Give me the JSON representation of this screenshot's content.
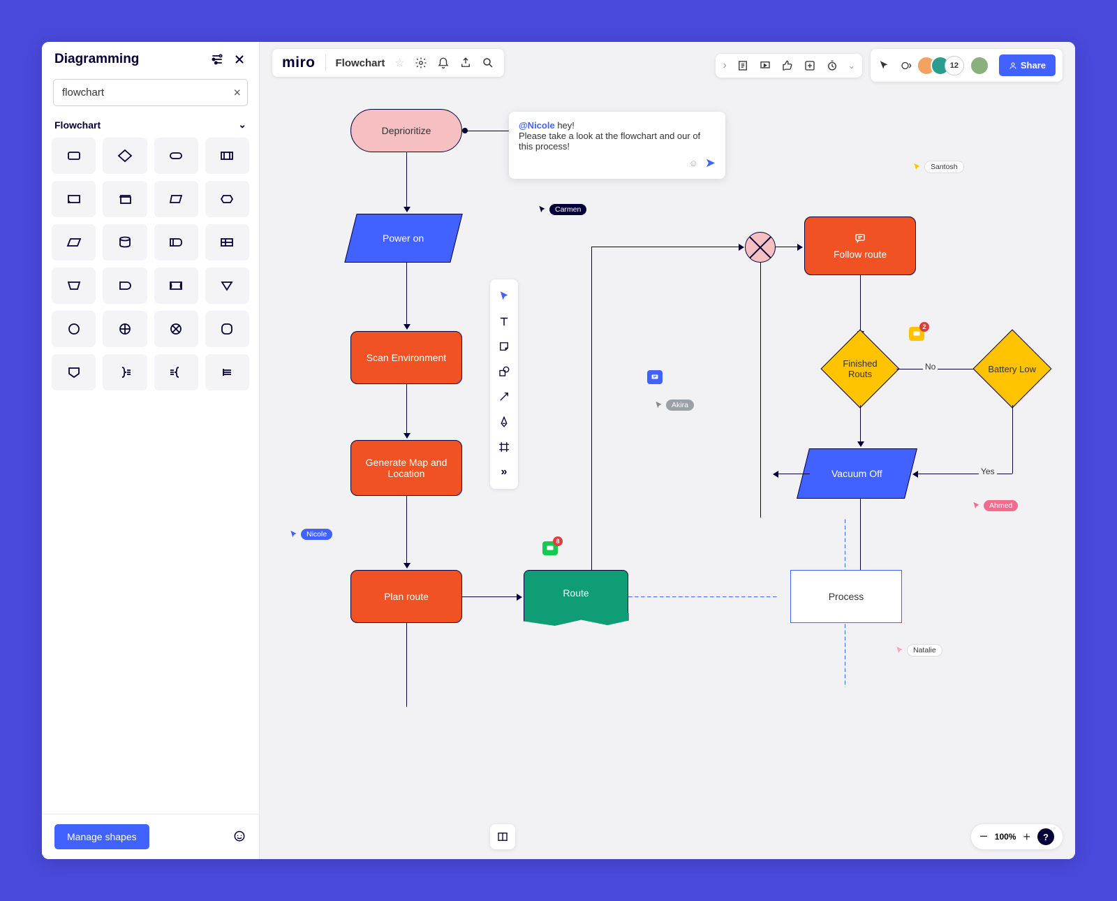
{
  "sidebar": {
    "title": "Diagramming",
    "search_value": "flowchart",
    "category": "Flowchart",
    "manage": "Manage shapes"
  },
  "topbar": {
    "logo": "miro",
    "board": "Flowchart"
  },
  "collab": {
    "count": "12",
    "share": "Share"
  },
  "zoom": {
    "level": "100%"
  },
  "nodes": {
    "deprioritize": "Deprioritize",
    "power_on": "Power on",
    "scan": "Scan Environment",
    "genmap": "Generate Map and Location",
    "plan": "Plan route",
    "route": "Route",
    "process": "Process",
    "follow": "Follow route",
    "finished": "Finished Routs",
    "battery": "Battery Low",
    "vacuum": "Vacuum Off"
  },
  "edges": {
    "no": "No",
    "yes": "Yes"
  },
  "comment": {
    "mention": "@Nicole",
    "line1": " hey!",
    "line2": "Please take a look at the flowchart and our of this process!"
  },
  "comment_badges": {
    "green": "8",
    "orange": "2"
  },
  "cursors": {
    "carmen": "Carmen",
    "akira": "Akira",
    "nicole": "Nicole",
    "santosh": "Santosh",
    "ahmed": "Ahmed",
    "natalie": "Natalie"
  }
}
